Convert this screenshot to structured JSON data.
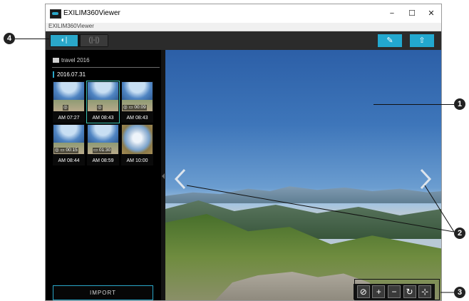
{
  "window": {
    "title": "EXILIM360Viewer",
    "menu_label": "EXILIM360Viewer",
    "minimize": "−",
    "maximize": "☐",
    "close": "✕"
  },
  "toolbar": {
    "mode_a": "◐|",
    "mode_b": "(|-|)",
    "edit_icon": "✎",
    "share_icon": "⇧"
  },
  "sidebar": {
    "folder": "travel 2016",
    "date": "2016.07.31",
    "thumbnails": [
      {
        "time": "AM 07:27",
        "badge": "◎"
      },
      {
        "time": "AM 08:43",
        "badge": "◎"
      },
      {
        "time": "AM 08:43",
        "badge": "◎ ▭ 00:09"
      },
      {
        "time": "AM 08:44",
        "badge": "◎ ▭ 00:15"
      },
      {
        "time": "AM 08:59",
        "badge": "▭ 01:30"
      },
      {
        "time": "AM 10:00",
        "badge": ""
      }
    ],
    "import": "IMPORT"
  },
  "viewer_controls": {
    "gyro": "⊘",
    "zoom_in": "+",
    "zoom_out": "−",
    "rotate": "↻",
    "fit": "⊹"
  },
  "callouts": {
    "c1": "1",
    "c2": "2",
    "c3": "3",
    "c4": "4"
  },
  "colors": {
    "accent": "#2aa7c9",
    "toolbar_button": "#22a8cf",
    "selected_thumb": "#3cc1b2"
  }
}
